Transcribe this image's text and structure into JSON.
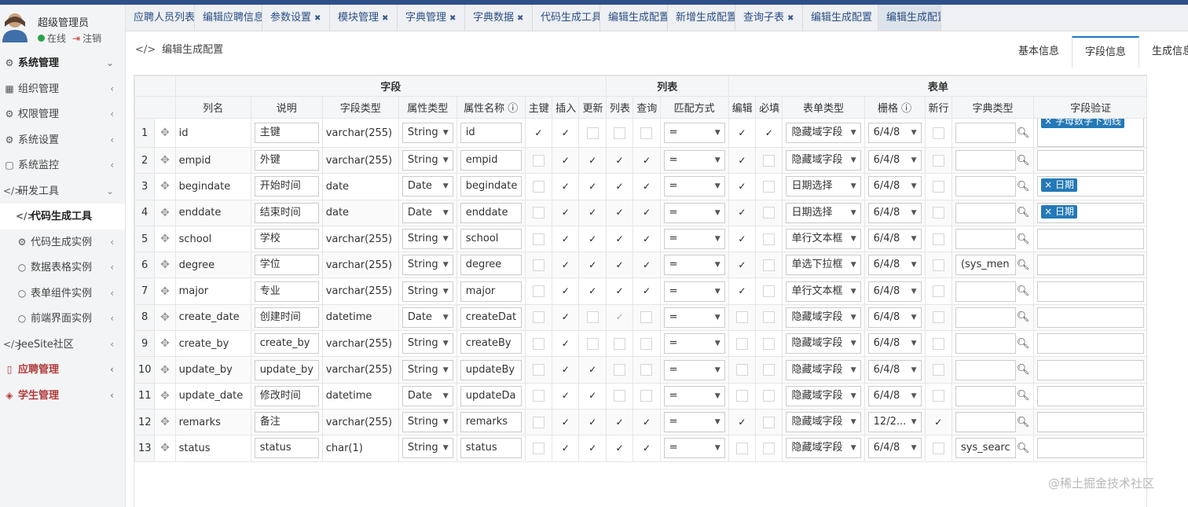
{
  "user": {
    "name": "超级管理员",
    "status": "在线",
    "logout": "注销"
  },
  "sidebar": [
    {
      "label": "系统管理",
      "icon": "gear-icon",
      "glyph": "⚙",
      "level": "top",
      "arrow": "⌄"
    },
    {
      "label": "组织管理",
      "icon": "grid-icon",
      "glyph": "▦",
      "level": "item",
      "arrow": "‹"
    },
    {
      "label": "权限管理",
      "icon": "cog-icon",
      "glyph": "⚙",
      "level": "item",
      "arrow": "‹"
    },
    {
      "label": "系统设置",
      "icon": "cog-icon",
      "glyph": "⚙",
      "level": "item",
      "arrow": "‹"
    },
    {
      "label": "系统监控",
      "icon": "monitor-icon",
      "glyph": "▢",
      "level": "item",
      "arrow": "‹"
    },
    {
      "label": "研发工具",
      "icon": "code-icon",
      "glyph": "</>",
      "level": "item",
      "arrow": "⌄"
    },
    {
      "label": "代码生成工具",
      "icon": "code-icon",
      "glyph": "</>",
      "level": "sub-active",
      "arrow": ""
    },
    {
      "label": "代码生成实例",
      "icon": "cog-icon",
      "glyph": "⚙",
      "level": "sub",
      "arrow": "‹"
    },
    {
      "label": "数据表格实例",
      "icon": "circle-icon",
      "glyph": "○",
      "level": "sub",
      "arrow": "‹"
    },
    {
      "label": "表单组件实例",
      "icon": "circle-icon",
      "glyph": "○",
      "level": "sub",
      "arrow": "‹"
    },
    {
      "label": "前端界面实例",
      "icon": "circle-icon",
      "glyph": "○",
      "level": "sub",
      "arrow": "‹"
    },
    {
      "label": "JeeSite社区",
      "icon": "code-icon",
      "glyph": "</>",
      "level": "item",
      "arrow": "‹"
    },
    {
      "label": "应聘管理",
      "icon": "book-icon",
      "glyph": "▯",
      "level": "red",
      "arrow": "‹"
    },
    {
      "label": "学生管理",
      "icon": "layers-icon",
      "glyph": "◈",
      "level": "red",
      "arrow": "‹"
    }
  ],
  "tabs": [
    "应聘人员列表",
    "编辑应聘信息",
    "参数设置",
    "模块管理",
    "字典管理",
    "字典数据",
    "代码生成工具",
    "编辑生成配置",
    "新增生成配置",
    "查询子表",
    "编辑生成配置",
    "编辑生成配置"
  ],
  "breadcrumb": "编辑生成配置",
  "panel_tabs": [
    "基本信息",
    "字段信息",
    "生成信息"
  ],
  "groups": {
    "field": "字段",
    "list": "列表",
    "form": "表单"
  },
  "columns": [
    "列名",
    "说明",
    "字段类型",
    "属性类型",
    "属性名称",
    "主键",
    "插入",
    "更新",
    "列表",
    "查询",
    "匹配方式",
    "编辑",
    "必填",
    "表单类型",
    "栅格",
    "新行",
    "字典类型",
    "字段验证"
  ],
  "rows": [
    {
      "no": "1",
      "col": "id",
      "desc": "主键",
      "jdbc": "varchar(255)",
      "ptype": "String",
      "pname": "id",
      "flags": [
        1,
        1,
        0,
        0,
        0,
        1,
        1
      ],
      "match": "=",
      "ftype": "隐藏域字段",
      "grid": "6/4/8",
      "newline": 0,
      "dict": "",
      "valid": "字母数字下划线"
    },
    {
      "no": "2",
      "col": "empid",
      "desc": "外键",
      "jdbc": "varchar(255)",
      "ptype": "String",
      "pname": "empid",
      "flags": [
        0,
        1,
        1,
        1,
        1,
        1,
        0
      ],
      "match": "=",
      "ftype": "隐藏域字段",
      "grid": "6/4/8",
      "newline": 0,
      "dict": "",
      "valid": ""
    },
    {
      "no": "3",
      "col": "begindate",
      "desc": "开始时间",
      "jdbc": "date",
      "ptype": "Date",
      "pname": "begindate",
      "flags": [
        0,
        1,
        1,
        1,
        1,
        1,
        0
      ],
      "match": "=",
      "ftype": "日期选择",
      "grid": "6/4/8",
      "newline": 0,
      "dict": "",
      "valid": "日期"
    },
    {
      "no": "4",
      "col": "enddate",
      "desc": "结束时间",
      "jdbc": "date",
      "ptype": "Date",
      "pname": "enddate",
      "flags": [
        0,
        1,
        1,
        1,
        1,
        1,
        0
      ],
      "match": "=",
      "ftype": "日期选择",
      "grid": "6/4/8",
      "newline": 0,
      "dict": "",
      "valid": "日期"
    },
    {
      "no": "5",
      "col": "school",
      "desc": "学校",
      "jdbc": "varchar(255)",
      "ptype": "String",
      "pname": "school",
      "flags": [
        0,
        1,
        1,
        1,
        1,
        1,
        0
      ],
      "match": "=",
      "ftype": "单行文本框",
      "grid": "6/4/8",
      "newline": 0,
      "dict": "",
      "valid": ""
    },
    {
      "no": "6",
      "col": "degree",
      "desc": "学位",
      "jdbc": "varchar(255)",
      "ptype": "String",
      "pname": "degree",
      "flags": [
        0,
        1,
        1,
        1,
        1,
        1,
        0
      ],
      "match": "=",
      "ftype": "单选下拉框",
      "grid": "6/4/8",
      "newline": 0,
      "dict": "(sys_men",
      "valid": ""
    },
    {
      "no": "7",
      "col": "major",
      "desc": "专业",
      "jdbc": "varchar(255)",
      "ptype": "String",
      "pname": "major",
      "flags": [
        0,
        1,
        1,
        1,
        1,
        1,
        0
      ],
      "match": "=",
      "ftype": "单行文本框",
      "grid": "6/4/8",
      "newline": 0,
      "dict": "",
      "valid": ""
    },
    {
      "no": "8",
      "col": "create_date",
      "desc": "创建时间",
      "jdbc": "datetime",
      "ptype": "Date",
      "pname": "createDat",
      "flags": [
        0,
        1,
        0,
        1,
        0,
        0,
        0
      ],
      "match": "=",
      "ftype": "隐藏域字段",
      "grid": "6/4/8",
      "newline": 0,
      "dict": "",
      "valid": ""
    },
    {
      "no": "9",
      "col": "create_by",
      "desc": "create_by",
      "jdbc": "varchar(255)",
      "ptype": "String",
      "pname": "createBy",
      "flags": [
        0,
        1,
        0,
        0,
        0,
        0,
        0
      ],
      "match": "=",
      "ftype": "隐藏域字段",
      "grid": "6/4/8",
      "newline": 0,
      "dict": "",
      "valid": ""
    },
    {
      "no": "10",
      "col": "update_by",
      "desc": "update_by",
      "jdbc": "varchar(255)",
      "ptype": "String",
      "pname": "updateBy",
      "flags": [
        0,
        1,
        1,
        0,
        0,
        0,
        0
      ],
      "match": "=",
      "ftype": "隐藏域字段",
      "grid": "6/4/8",
      "newline": 0,
      "dict": "",
      "valid": ""
    },
    {
      "no": "11",
      "col": "update_date",
      "desc": "修改时间",
      "jdbc": "datetime",
      "ptype": "Date",
      "pname": "updateDa",
      "flags": [
        0,
        1,
        1,
        0,
        0,
        0,
        0
      ],
      "match": "=",
      "ftype": "隐藏域字段",
      "grid": "6/4/8",
      "newline": 0,
      "dict": "",
      "valid": ""
    },
    {
      "no": "12",
      "col": "remarks",
      "desc": "备注",
      "jdbc": "varchar(255)",
      "ptype": "String",
      "pname": "remarks",
      "flags": [
        0,
        1,
        1,
        1,
        1,
        1,
        0
      ],
      "match": "=",
      "ftype": "隐藏域字段",
      "grid": "12/2...",
      "newline": 1,
      "dict": "",
      "valid": ""
    },
    {
      "no": "13",
      "col": "status",
      "desc": "status",
      "jdbc": "char(1)",
      "ptype": "String",
      "pname": "status",
      "flags": [
        0,
        1,
        1,
        1,
        1,
        0,
        0
      ],
      "match": "=",
      "ftype": "隐藏域字段",
      "grid": "6/4/8",
      "newline": 0,
      "dict": "sys_searc",
      "valid": ""
    }
  ],
  "watermark": "@稀土掘金技术社区",
  "colors": {
    "accent": "#2479b8",
    "topbar": "#2f4f88",
    "danger": "#b23b3b",
    "online": "#2ca24b"
  }
}
